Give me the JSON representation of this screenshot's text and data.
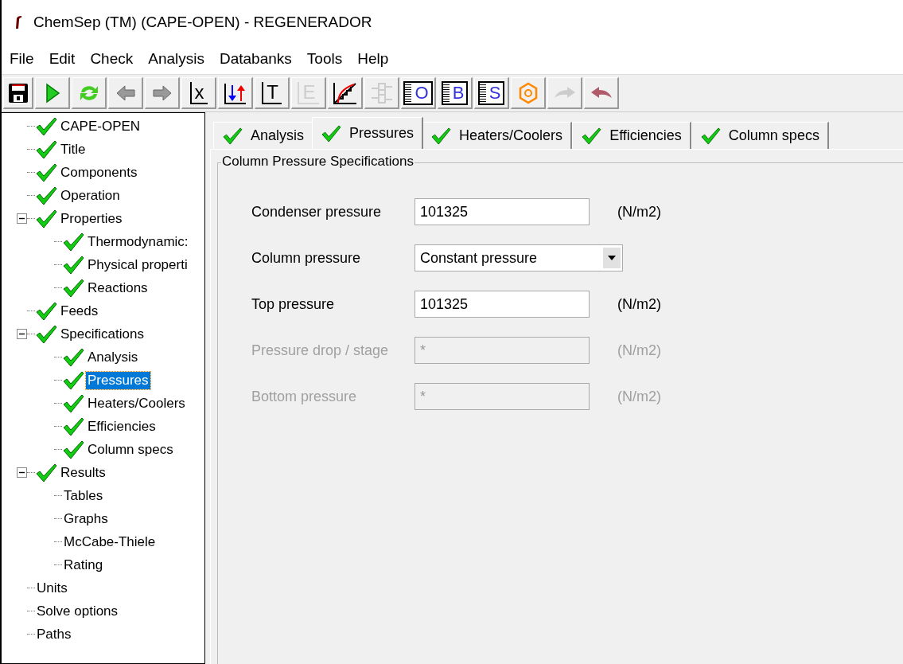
{
  "window": {
    "title": "ChemSep (TM) (CAPE-OPEN) - REGENERADOR"
  },
  "menu": [
    "File",
    "Edit",
    "Check",
    "Analysis",
    "Databanks",
    "Tools",
    "Help"
  ],
  "toolbar": [
    {
      "kind": "save",
      "disabled": false
    },
    {
      "kind": "run",
      "disabled": false
    },
    {
      "kind": "refresh",
      "disabled": false
    },
    {
      "kind": "back",
      "disabled": false
    },
    {
      "kind": "forward",
      "disabled": false
    },
    {
      "kind": "letter",
      "glyph": "x",
      "disabled": false
    },
    {
      "kind": "updown",
      "disabled": false
    },
    {
      "kind": "letter",
      "glyph": "T",
      "disabled": false
    },
    {
      "kind": "letter",
      "glyph": "E",
      "disabled": true
    },
    {
      "kind": "graph",
      "disabled": false
    },
    {
      "kind": "column",
      "disabled": true
    },
    {
      "kind": "listletter",
      "glyph": "O",
      "disabled": false
    },
    {
      "kind": "listletter",
      "glyph": "B",
      "disabled": false
    },
    {
      "kind": "listletter",
      "glyph": "S",
      "disabled": false
    },
    {
      "kind": "hexagon",
      "disabled": false
    },
    {
      "kind": "redo",
      "disabled": true
    },
    {
      "kind": "undo",
      "disabled": false
    }
  ],
  "tree": [
    {
      "label": "CAPE-OPEN",
      "checked": true,
      "selected": false
    },
    {
      "label": "Title",
      "checked": true,
      "selected": false
    },
    {
      "label": "Components",
      "checked": true,
      "selected": false
    },
    {
      "label": "Operation",
      "checked": true,
      "selected": false
    },
    {
      "label": "Properties",
      "checked": true,
      "selected": false,
      "expanded": true,
      "children": [
        {
          "label": "Thermodynamic:",
          "checked": true,
          "selected": false
        },
        {
          "label": "Physical properti",
          "checked": true,
          "selected": false
        },
        {
          "label": "Reactions",
          "checked": true,
          "selected": false
        }
      ]
    },
    {
      "label": "Feeds",
      "checked": true,
      "selected": false
    },
    {
      "label": "Specifications",
      "checked": true,
      "selected": false,
      "expanded": true,
      "children": [
        {
          "label": "Analysis",
          "checked": true,
          "selected": false
        },
        {
          "label": "Pressures",
          "checked": true,
          "selected": true
        },
        {
          "label": "Heaters/Coolers",
          "checked": true,
          "selected": false
        },
        {
          "label": "Efficiencies",
          "checked": true,
          "selected": false
        },
        {
          "label": "Column specs",
          "checked": true,
          "selected": false
        }
      ]
    },
    {
      "label": "Results",
      "checked": true,
      "selected": false,
      "expanded": true,
      "children": [
        {
          "label": "Tables",
          "checked": false,
          "selected": false
        },
        {
          "label": "Graphs",
          "checked": false,
          "selected": false
        },
        {
          "label": "McCabe-Thiele",
          "checked": false,
          "selected": false
        },
        {
          "label": "Rating",
          "checked": false,
          "selected": false
        }
      ]
    },
    {
      "label": "Units",
      "checked": false,
      "selected": false
    },
    {
      "label": "Solve options",
      "checked": false,
      "selected": false
    },
    {
      "label": "Paths",
      "checked": false,
      "selected": false
    }
  ],
  "tabs": [
    {
      "label": "Analysis",
      "checked": true,
      "selected": false
    },
    {
      "label": "Pressures",
      "checked": true,
      "selected": true
    },
    {
      "label": "Heaters/Coolers",
      "checked": true,
      "selected": false
    },
    {
      "label": "Efficiencies",
      "checked": true,
      "selected": false
    },
    {
      "label": "Column specs",
      "checked": true,
      "selected": false
    }
  ],
  "group": {
    "title": "Column Pressure Specifications",
    "fields": [
      {
        "kind": "input",
        "label": "Condenser pressure",
        "value": "101325",
        "unit": "(N/m2)",
        "disabled": false
      },
      {
        "kind": "dropdown",
        "label": "Column pressure",
        "value": "Constant pressure",
        "disabled": false
      },
      {
        "kind": "input",
        "label": "Top pressure",
        "value": "101325",
        "unit": "(N/m2)",
        "disabled": false
      },
      {
        "kind": "input",
        "label": "Pressure drop / stage",
        "value": "*",
        "unit": "(N/m2)",
        "disabled": true
      },
      {
        "kind": "input",
        "label": "Bottom pressure",
        "value": "*",
        "unit": "(N/m2)",
        "disabled": true
      }
    ]
  }
}
